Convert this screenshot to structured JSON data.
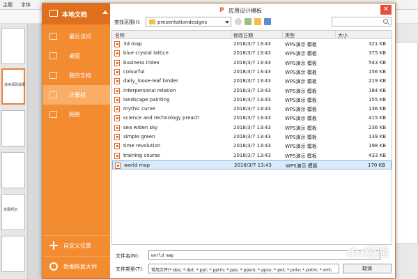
{
  "background": {
    "toolbar_items": [
      {
        "label": "主题"
      },
      {
        "label": "字体"
      }
    ],
    "thumb_texts": [
      "连续调研成果",
      "发展规划"
    ]
  },
  "dialog": {
    "sidebar": {
      "title": "本地文档",
      "items": [
        {
          "label": "最近访问",
          "icon": "clock-icon"
        },
        {
          "label": "桌面",
          "icon": "desktop-icon"
        },
        {
          "label": "我的文档",
          "icon": "documents-icon"
        },
        {
          "label": "计算机",
          "icon": "computer-icon"
        },
        {
          "label": "网络",
          "icon": "network-icon"
        }
      ],
      "bottom_items": [
        {
          "label": "自定义位置",
          "icon": "plus-icon"
        },
        {
          "label": "数据恢复大师",
          "icon": "recover-icon"
        }
      ],
      "active_index": 3
    },
    "title": "应用设计模板",
    "look_in": {
      "label": "查找范围(I):",
      "value": "presentationdesigns"
    },
    "columns": {
      "name": "名称",
      "modified": "修改日期",
      "type": "类型",
      "size": "大小"
    },
    "files": [
      {
        "name": "3d map",
        "modified": "2018/3/7 13:43",
        "type": "WPS演示 模板",
        "size": "321 KB"
      },
      {
        "name": "blue crystal lattice",
        "modified": "2018/3/7 13:43",
        "type": "WPS演示 模板",
        "size": "375 KB"
      },
      {
        "name": "business index",
        "modified": "2018/3/7 13:43",
        "type": "WPS演示 模板",
        "size": "543 KB"
      },
      {
        "name": "colourful",
        "modified": "2018/3/7 13:43",
        "type": "WPS演示 模板",
        "size": "156 KB"
      },
      {
        "name": "daily_loose-leaf binder",
        "modified": "2018/3/7 13:43",
        "type": "WPS演示 模板",
        "size": "219 KB"
      },
      {
        "name": "interpersonal relation",
        "modified": "2018/3/7 13:43",
        "type": "WPS演示 模板",
        "size": "184 KB"
      },
      {
        "name": "landscape painting",
        "modified": "2018/3/7 13:43",
        "type": "WPS演示 模板",
        "size": "155 KB"
      },
      {
        "name": "mythic curve",
        "modified": "2018/3/7 13:43",
        "type": "WPS演示 模板",
        "size": "136 KB"
      },
      {
        "name": "science and technology preach",
        "modified": "2018/3/7 13:43",
        "type": "WPS演示 模板",
        "size": "415 KB"
      },
      {
        "name": "sea widen sky",
        "modified": "2018/3/7 13:43",
        "type": "WPS演示 模板",
        "size": "236 KB"
      },
      {
        "name": "simple green",
        "modified": "2018/3/7 13:43",
        "type": "WPS演示 模板",
        "size": "139 KB"
      },
      {
        "name": "time revolution",
        "modified": "2018/3/7 13:43",
        "type": "WPS演示 模板",
        "size": "198 KB"
      },
      {
        "name": "training course",
        "modified": "2018/3/7 13:43",
        "type": "WPS演示 模板",
        "size": "433 KB"
      },
      {
        "name": "world map",
        "modified": "2018/3/7 13:43",
        "type": "WPS演示 模板",
        "size": "170 KB"
      }
    ],
    "selected_index": 13,
    "filename": {
      "label": "文件名(N):",
      "value": "world map"
    },
    "filetype": {
      "label": "文件类型(T):",
      "value": "常用文件(*.dps; *.dpt; *.ppt; *.pptm; *.pps; *.ppsm; *.ppsx; *.pot; *.potx; *.potm; *.xml;"
    },
    "cancel_label": "取消"
  },
  "watermark": "du经验",
  "colors": {
    "sidebar": "#f38b30",
    "sidebar_header": "#de6f1d",
    "selection": "#dbe9f8",
    "close": "#e74c3c"
  }
}
